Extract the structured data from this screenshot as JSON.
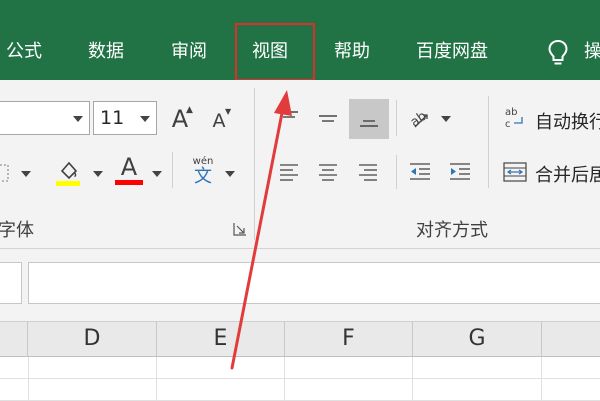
{
  "tabs": [
    {
      "key": "formulas",
      "label": "公式"
    },
    {
      "key": "data",
      "label": "数据"
    },
    {
      "key": "review",
      "label": "审阅"
    },
    {
      "key": "view",
      "label": "视图"
    },
    {
      "key": "help",
      "label": "帮助"
    },
    {
      "key": "baidu",
      "label": "百度网盘"
    },
    {
      "key": "tell",
      "label": "操"
    }
  ],
  "font_group": {
    "font_size": "11",
    "grow_icon": "A",
    "shrink_icon": "A",
    "font_color_icon": "A",
    "phonetic_top": "wén",
    "phonetic_bottom": "文",
    "label": "字体"
  },
  "align_group": {
    "wrap_text": "自动换行",
    "merge_center": "合并后居",
    "label": "对齐方式"
  },
  "columns": [
    "D",
    "E",
    "F",
    "G"
  ],
  "colors": {
    "ribbon_green": "#217346",
    "highlight_box": "#d9302c",
    "fill_yellow": "#ffff00",
    "font_red": "#ff0000",
    "arrow_red": "#e23b3b"
  }
}
